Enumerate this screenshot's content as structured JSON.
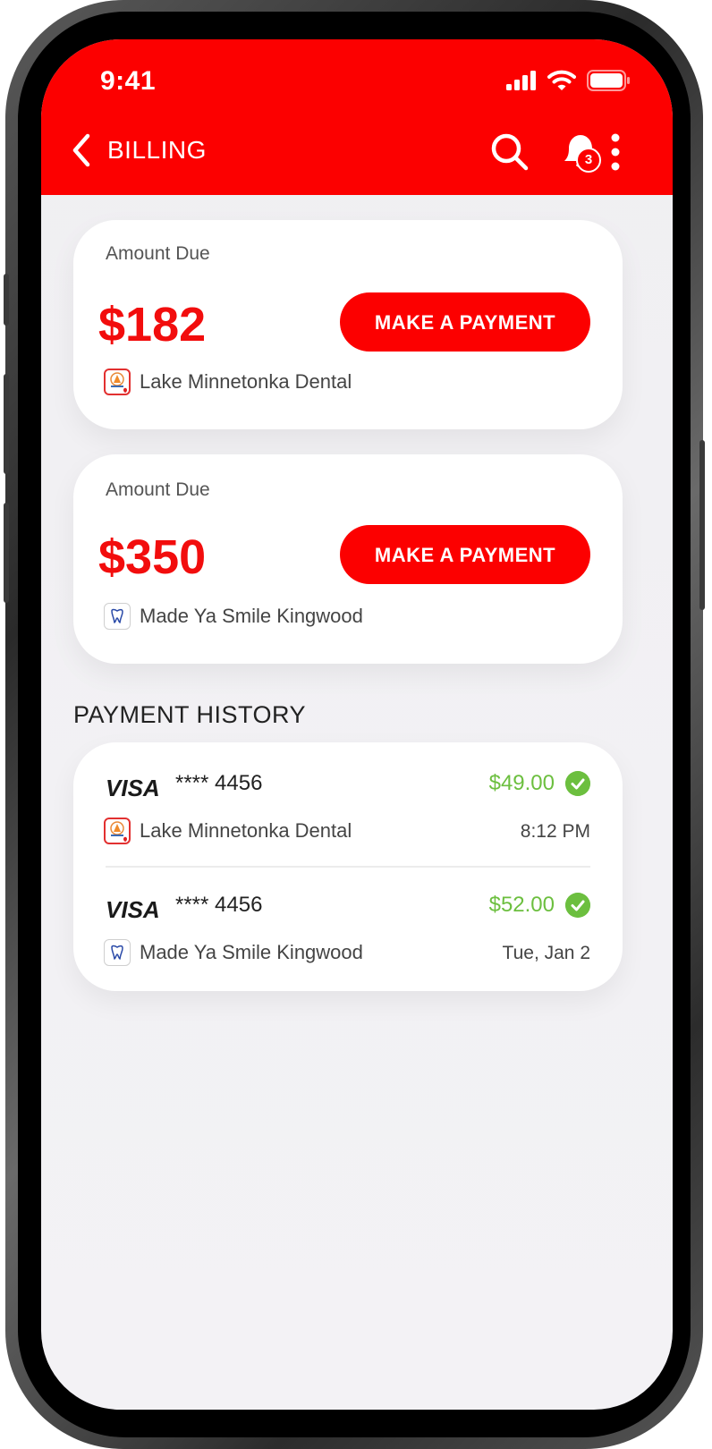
{
  "status_bar": {
    "time": "9:41"
  },
  "nav": {
    "title": "BILLING",
    "notification_count": "3"
  },
  "amounts_due": [
    {
      "label": "Amount Due",
      "amount": "$182",
      "button": "MAKE A PAYMENT",
      "clinic": "Lake Minnetonka Dental"
    },
    {
      "label": "Amount Due",
      "amount": "$350",
      "button": "MAKE A PAYMENT",
      "clinic": "Made Ya Smile Kingwood"
    }
  ],
  "payment_history": {
    "title": "PAYMENT HISTORY",
    "items": [
      {
        "card_brand": "VISA",
        "card_number": "**** 4456",
        "amount": "$49.00",
        "clinic": "Lake Minnetonka Dental",
        "time": "8:12 PM"
      },
      {
        "card_brand": "VISA",
        "card_number": "**** 4456",
        "amount": "$52.00",
        "clinic": "Made Ya Smile Kingwood",
        "time": "Tue, Jan 2"
      }
    ]
  },
  "colors": {
    "brand_red": "#fc0000",
    "amount_red": "#f20d0d",
    "success_green": "#6cbf3f"
  }
}
